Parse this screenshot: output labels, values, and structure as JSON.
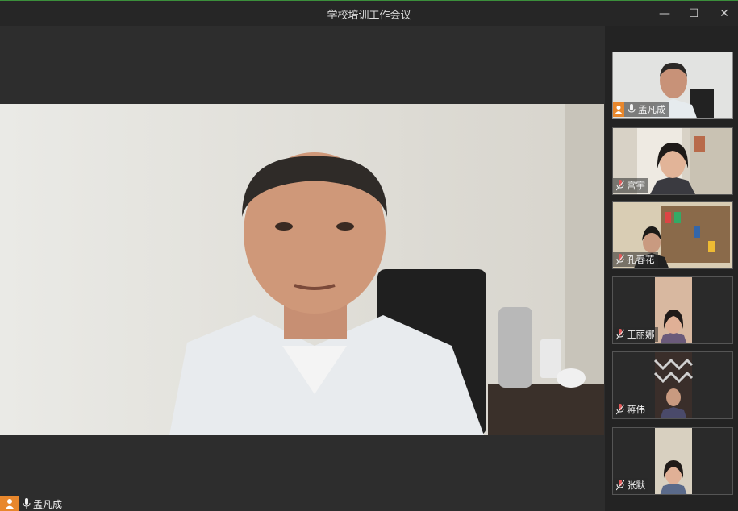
{
  "window": {
    "title": "学校培训工作会议",
    "minimize": "—",
    "maximize": "☐",
    "close": "✕"
  },
  "main_speaker": {
    "name": "孟凡成"
  },
  "participants": [
    {
      "name": "孟凡成",
      "host": true
    },
    {
      "name": "宫宇",
      "host": false
    },
    {
      "name": "孔春花",
      "host": false
    },
    {
      "name": "王丽娜",
      "host": false
    },
    {
      "name": "蒋伟",
      "host": false
    },
    {
      "name": "张默",
      "host": false
    }
  ],
  "colors": {
    "accent": "#e8872c",
    "mic_muted": "#e05a5a"
  }
}
